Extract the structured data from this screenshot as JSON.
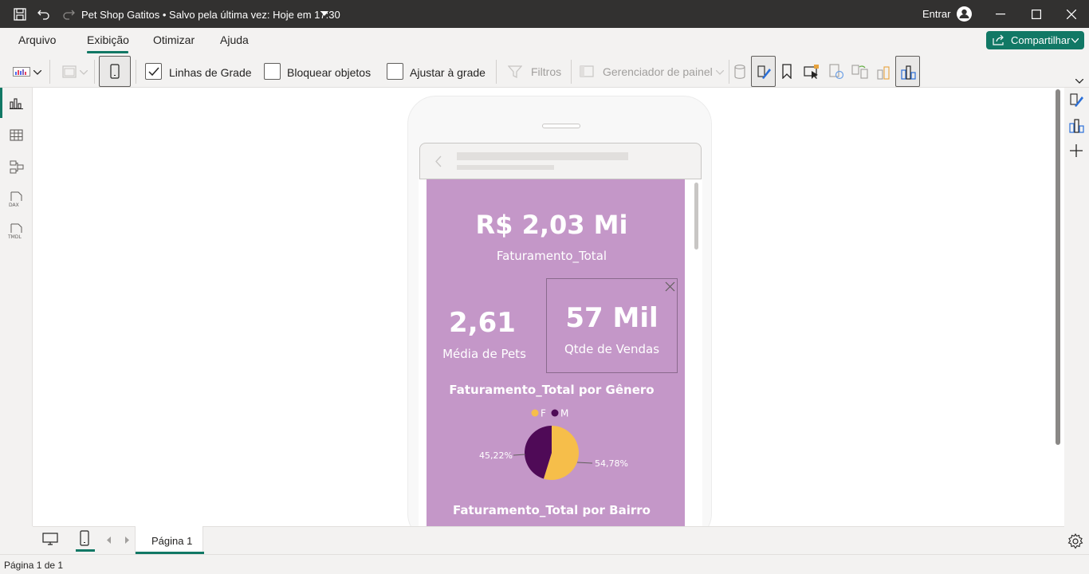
{
  "titlebar": {
    "doc_title": "Pet Shop Gatitos • Salvo pela última vez: Hoje em 17:30",
    "signin_label": "Entrar"
  },
  "menu": {
    "tabs": [
      "Arquivo",
      "Exibição",
      "Otimizar",
      "Ajuda"
    ],
    "active_tab": "Exibição",
    "share_label": "Compartilhar"
  },
  "toolbar": {
    "gridlines_label": "Linhas de Grade",
    "gridlines_checked": true,
    "lock_objects_label": "Bloquear objetos",
    "snap_to_grid_label": "Ajustar à grade",
    "filters_label": "Filtros",
    "panel_manager_label": "Gerenciador de painel"
  },
  "report": {
    "kpi_total_value": "R$ 2,03 Mi",
    "kpi_total_label": "Faturamento_Total",
    "kpi_pets_value": "2,61",
    "kpi_pets_label": "Média de Pets",
    "kpi_sales_value": "57 Mil",
    "kpi_sales_label": "Qtde de Vendas",
    "pie_title": "Faturamento_Total por Gênero",
    "bairro_title": "Faturamento_Total por Bairro"
  },
  "chart_data": {
    "type": "pie",
    "title": "Faturamento_Total por Gênero",
    "series": [
      {
        "name": "F",
        "value": 54.78,
        "label": "54,78%",
        "color": "#f6be4a"
      },
      {
        "name": "M",
        "value": 45.22,
        "label": "45,22%",
        "color": "#4f0a57"
      }
    ],
    "legend": "top"
  },
  "pages": {
    "tab_label": "Página 1",
    "status": "Página 1 de 1"
  },
  "colors": {
    "accent": "#117865",
    "report_bg": "#c497c8"
  }
}
